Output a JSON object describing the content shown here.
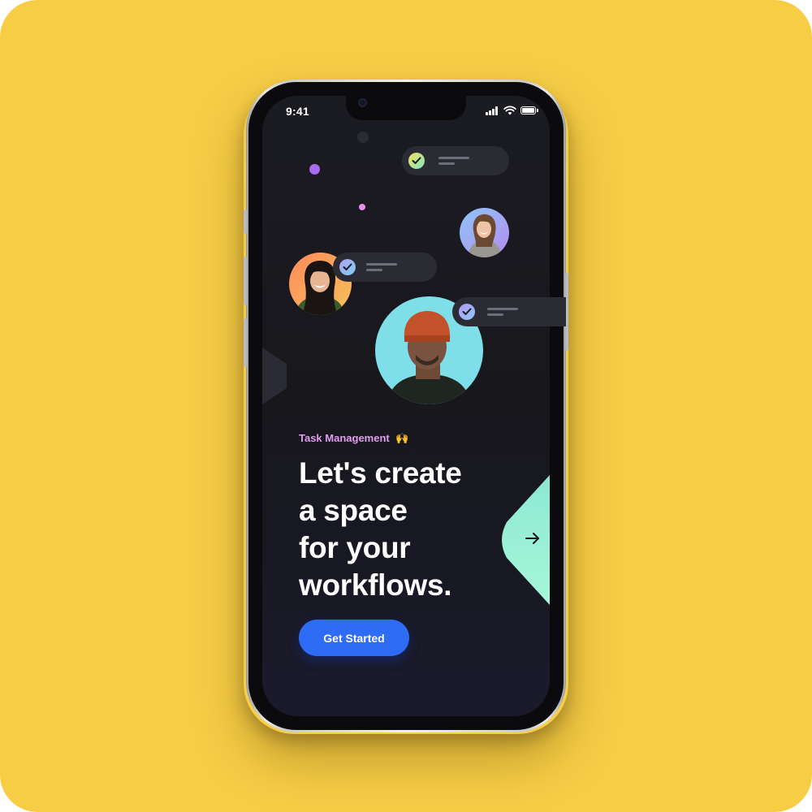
{
  "status_bar": {
    "time": "9:41"
  },
  "onboarding": {
    "category_label": "Task Management",
    "category_emoji": "🙌",
    "headline_lines": [
      "Let's create",
      "a space",
      "for your",
      "workflows."
    ],
    "cta_label": "Get Started"
  },
  "icons": {
    "signal": "cellular-signal-icon",
    "wifi": "wifi-icon",
    "battery": "battery-icon",
    "check": "check-icon",
    "next": "arrow-right-icon"
  },
  "colors": {
    "page_background": "#f6cd45",
    "screen_background": "#17171c",
    "accent_pink": "#e49cf0",
    "cta_blue": "#2f6cf6",
    "next_tab_mint": "#98f5d8"
  }
}
